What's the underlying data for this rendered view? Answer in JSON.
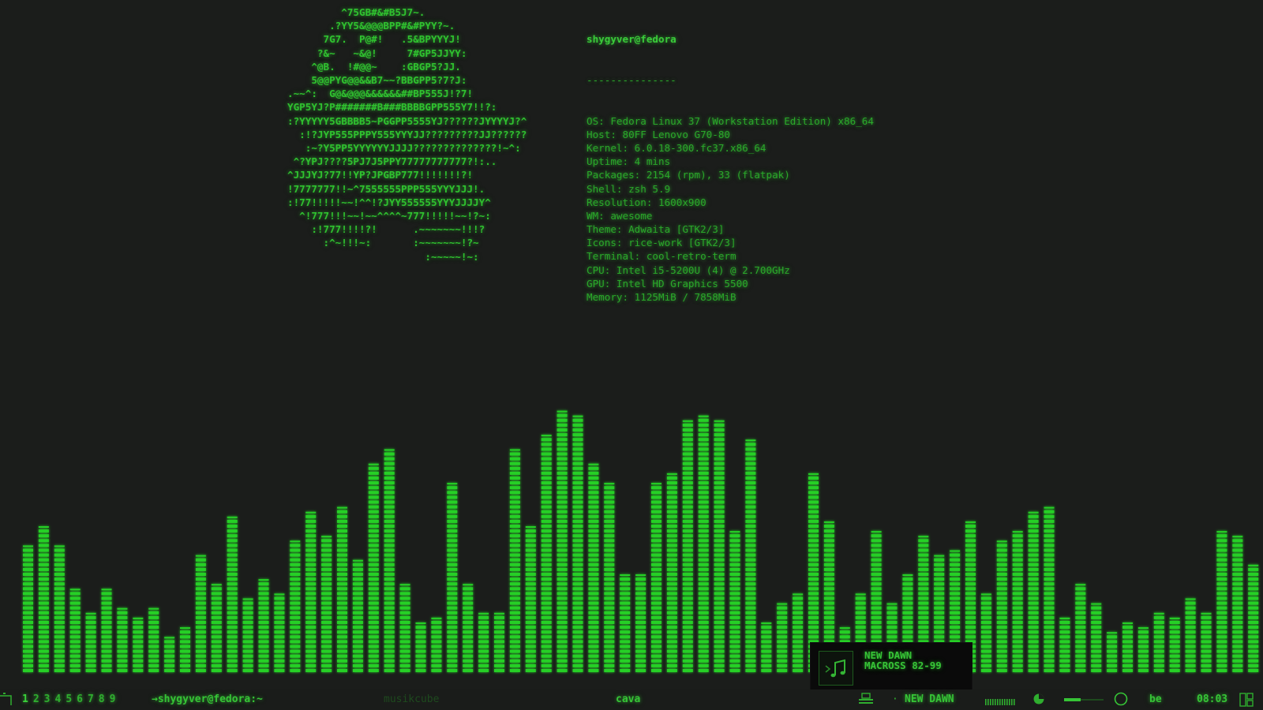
{
  "colors": {
    "background": "#1b1d1b",
    "accent": "#2fc22f",
    "bar": "#26d026",
    "dim": "#1e4a1e"
  },
  "ascii_logo": [
    "         ^75GB#&#B5J7~.",
    "       .?YY5&@@@BPP#&#PYY?~.",
    "      7G7.  P@#!   .5&BPYYYJ!",
    "     ?&~   ~&@!     7#GP5JJYY:",
    "    ^@B.  !#@@~    :GBGP5?JJ.",
    "    5@@PYG@@&&B7~~?BBGPP5?7?J:",
    ".~~^:  G@&@@@&&&&&&##BP555J!?7!",
    "YGP5YJ?P#######B###BBBBGPP555Y7!!?:",
    ":?YYYYY5GBBBB5~PGGPP5555YJ??????JYYYYJ?^",
    "  :!?JYP555PPPY555YYYJJ?????????JJ??????",
    "   :~?Y5PP5YYYYYYJJJJ??????????????!~^:",
    " ^?YPJ????5PJ7J5PPY77777777777?!:..",
    "^JJJYJ?77!!YP?JPGBP777!!!!!!!?!",
    "!7777777!!~^7555555PPP555YYYJJJ!.",
    ":!77!!!!!~~!^^!?JYY555555YYYJJJJY^",
    "  ^!777!!!~~!~~^^^^~777!!!!!~~!?~:",
    "    :!777!!!!?!      .~~~~~~~!!!?",
    "      :^~!!!~:       :~~~~~~~!?~",
    "                       :~~~~~!~:"
  ],
  "sysinfo": {
    "user_host": "shygyver@fedora",
    "separator": "---------------",
    "rows": [
      {
        "k": "OS",
        "v": "Fedora Linux 37 (Workstation Edition) x86_64"
      },
      {
        "k": "Host",
        "v": "80FF Lenovo G70-80"
      },
      {
        "k": "Kernel",
        "v": "6.0.18-300.fc37.x86_64"
      },
      {
        "k": "Uptime",
        "v": "4 mins"
      },
      {
        "k": "Packages",
        "v": "2154 (rpm), 33 (flatpak)"
      },
      {
        "k": "Shell",
        "v": "zsh 5.9"
      },
      {
        "k": "Resolution",
        "v": "1600x900"
      },
      {
        "k": "WM",
        "v": "awesome"
      },
      {
        "k": "Theme",
        "v": "Adwaita [GTK2/3]"
      },
      {
        "k": "Icons",
        "v": "rice-work [GTK2/3]"
      },
      {
        "k": "Terminal",
        "v": "cool-retro-term"
      },
      {
        "k": "CPU",
        "v": "Intel i5-5200U (4) @ 2.700GHz"
      },
      {
        "k": "GPU",
        "v": "Intel HD Graphics 5500"
      },
      {
        "k": "Memory",
        "v": "1125MiB / 7858MiB"
      }
    ]
  },
  "visualizer": {
    "levels": [
      0.47,
      0.55,
      0.47,
      0.31,
      0.22,
      0.3,
      0.24,
      0.2,
      0.24,
      0.13,
      0.16,
      0.43,
      0.33,
      0.58,
      0.27,
      0.35,
      0.29,
      0.48,
      0.59,
      0.51,
      0.61,
      0.42,
      0.78,
      0.83,
      0.33,
      0.18,
      0.2,
      0.7,
      0.33,
      0.21,
      0.21,
      0.83,
      0.55,
      0.88,
      0.98,
      0.96,
      0.78,
      0.7,
      0.36,
      0.37,
      0.7,
      0.74,
      0.95,
      0.96,
      0.94,
      0.52,
      0.86,
      0.19,
      0.25,
      0.29,
      0.74,
      0.56,
      0.17,
      0.29,
      0.52,
      0.25,
      0.37,
      0.5,
      0.44,
      0.46,
      0.56,
      0.29,
      0.49,
      0.52,
      0.6,
      0.61,
      0.2,
      0.33,
      0.25,
      0.14,
      0.19,
      0.17,
      0.21,
      0.2,
      0.28,
      0.22,
      0.53,
      0.5,
      0.4
    ]
  },
  "now_playing": {
    "title": "NEW DAWN",
    "album": "MACROSS 82-99",
    "bar_label": "NEW DAWN",
    "volume": 0.42
  },
  "statusbar": {
    "tags": [
      "1",
      "2",
      "3",
      "4",
      "5",
      "6",
      "7",
      "8",
      "9"
    ],
    "active_window": "→shygyver@fedora:~",
    "tasks": [
      "musikcube",
      "cava"
    ],
    "kb_layout": "be",
    "clock": "08:03"
  }
}
